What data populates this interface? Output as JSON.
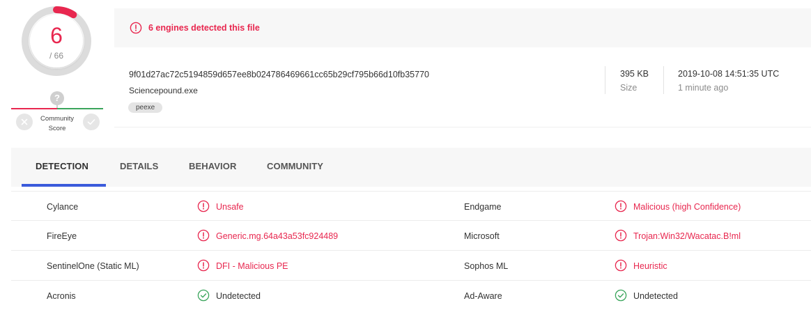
{
  "score": {
    "detected": "6",
    "total": "/ 66",
    "detected_count": 6,
    "total_count": 66,
    "community_label": "Community Score",
    "community_question": "?"
  },
  "colors": {
    "malicious": "#e8274f",
    "clean": "#3ba55c",
    "tab_active": "#3b5bdb"
  },
  "banner": {
    "text": "6 engines detected this file"
  },
  "file": {
    "sha256": "9f01d27ac72c5194859d657ee8b024786469661cc65b29cf795b66d10fb35770",
    "name": "Sciencepound.exe",
    "tag": "peexe",
    "size_value": "395 KB",
    "size_label": "Size",
    "date_value": "2019-10-08 14:51:35 UTC",
    "date_label": "1 minute ago"
  },
  "tabs": [
    {
      "label": "DETECTION",
      "active": true
    },
    {
      "label": "DETAILS",
      "active": false
    },
    {
      "label": "BEHAVIOR",
      "active": false
    },
    {
      "label": "COMMUNITY",
      "active": false
    }
  ],
  "detections": [
    {
      "left": {
        "engine": "Cylance",
        "result": "Unsafe",
        "status": "malicious"
      },
      "right": {
        "engine": "Endgame",
        "result": "Malicious (high Confidence)",
        "status": "malicious"
      }
    },
    {
      "left": {
        "engine": "FireEye",
        "result": "Generic.mg.64a43a53fc924489",
        "status": "malicious"
      },
      "right": {
        "engine": "Microsoft",
        "result": "Trojan:Win32/Wacatac.B!ml",
        "status": "malicious"
      }
    },
    {
      "left": {
        "engine": "SentinelOne (Static ML)",
        "result": "DFI - Malicious PE",
        "status": "malicious"
      },
      "right": {
        "engine": "Sophos ML",
        "result": "Heuristic",
        "status": "malicious"
      }
    },
    {
      "left": {
        "engine": "Acronis",
        "result": "Undetected",
        "status": "clean"
      },
      "right": {
        "engine": "Ad-Aware",
        "result": "Undetected",
        "status": "clean"
      }
    }
  ]
}
